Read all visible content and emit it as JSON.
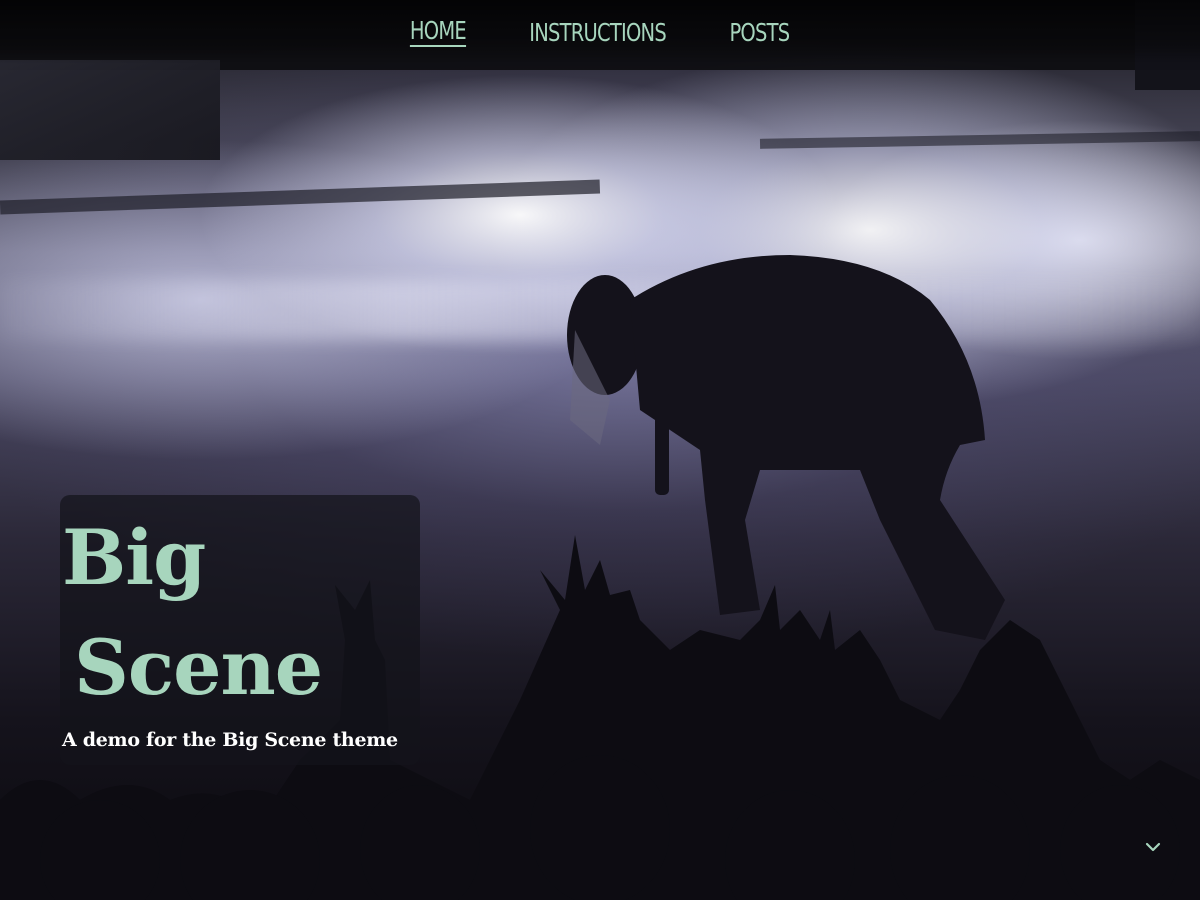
{
  "nav": {
    "items": [
      {
        "label": "Home",
        "active": true
      },
      {
        "label": "Instructions",
        "active": false
      },
      {
        "label": "Posts",
        "active": false
      }
    ]
  },
  "hero": {
    "title_line1": "Big",
    "title_line2": "Scene",
    "subtitle": "A demo for the Big Scene theme",
    "image_alt": "concert-stage-diver-silhouette"
  },
  "colors": {
    "accent": "#a7d5bd",
    "card_bg": "#14141a",
    "text_light": "#ffffff"
  },
  "icons": {
    "scroll": "chevron-down-icon"
  }
}
